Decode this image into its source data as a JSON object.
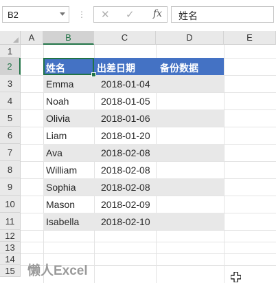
{
  "formula_bar": {
    "name_box": "B2",
    "separator": "⋮",
    "cancel_glyph": "✕",
    "enter_glyph": "✓",
    "fx_label": "fx",
    "content": "姓名"
  },
  "sheet": {
    "columns": [
      "A",
      "B",
      "C",
      "D",
      "E"
    ],
    "selected_column": "B",
    "rows": [
      "1",
      "2",
      "3",
      "4",
      "5",
      "6",
      "7",
      "8",
      "9",
      "10",
      "11",
      "12",
      "13",
      "14",
      "15"
    ],
    "selected_row": "2",
    "table": {
      "headers": [
        "姓名",
        "出差日期",
        "备份数据"
      ],
      "records": [
        {
          "name": "Emma",
          "date": "2018-01-04"
        },
        {
          "name": "Noah",
          "date": "2018-01-05"
        },
        {
          "name": "Olivia",
          "date": "2018-01-06"
        },
        {
          "name": "Liam",
          "date": "2018-01-20"
        },
        {
          "name": "Ava",
          "date": "2018-02-08"
        },
        {
          "name": "William",
          "date": "2018-02-08"
        },
        {
          "name": "Sophia",
          "date": "2018-02-08"
        },
        {
          "name": "Mason",
          "date": "2018-02-09"
        },
        {
          "name": "Isabella",
          "date": "2018-02-10"
        }
      ],
      "header_color": "#4472c4",
      "stripe_color": "#e8e8e8"
    },
    "selection_color": "#217346"
  },
  "watermark": "懒人Excel"
}
